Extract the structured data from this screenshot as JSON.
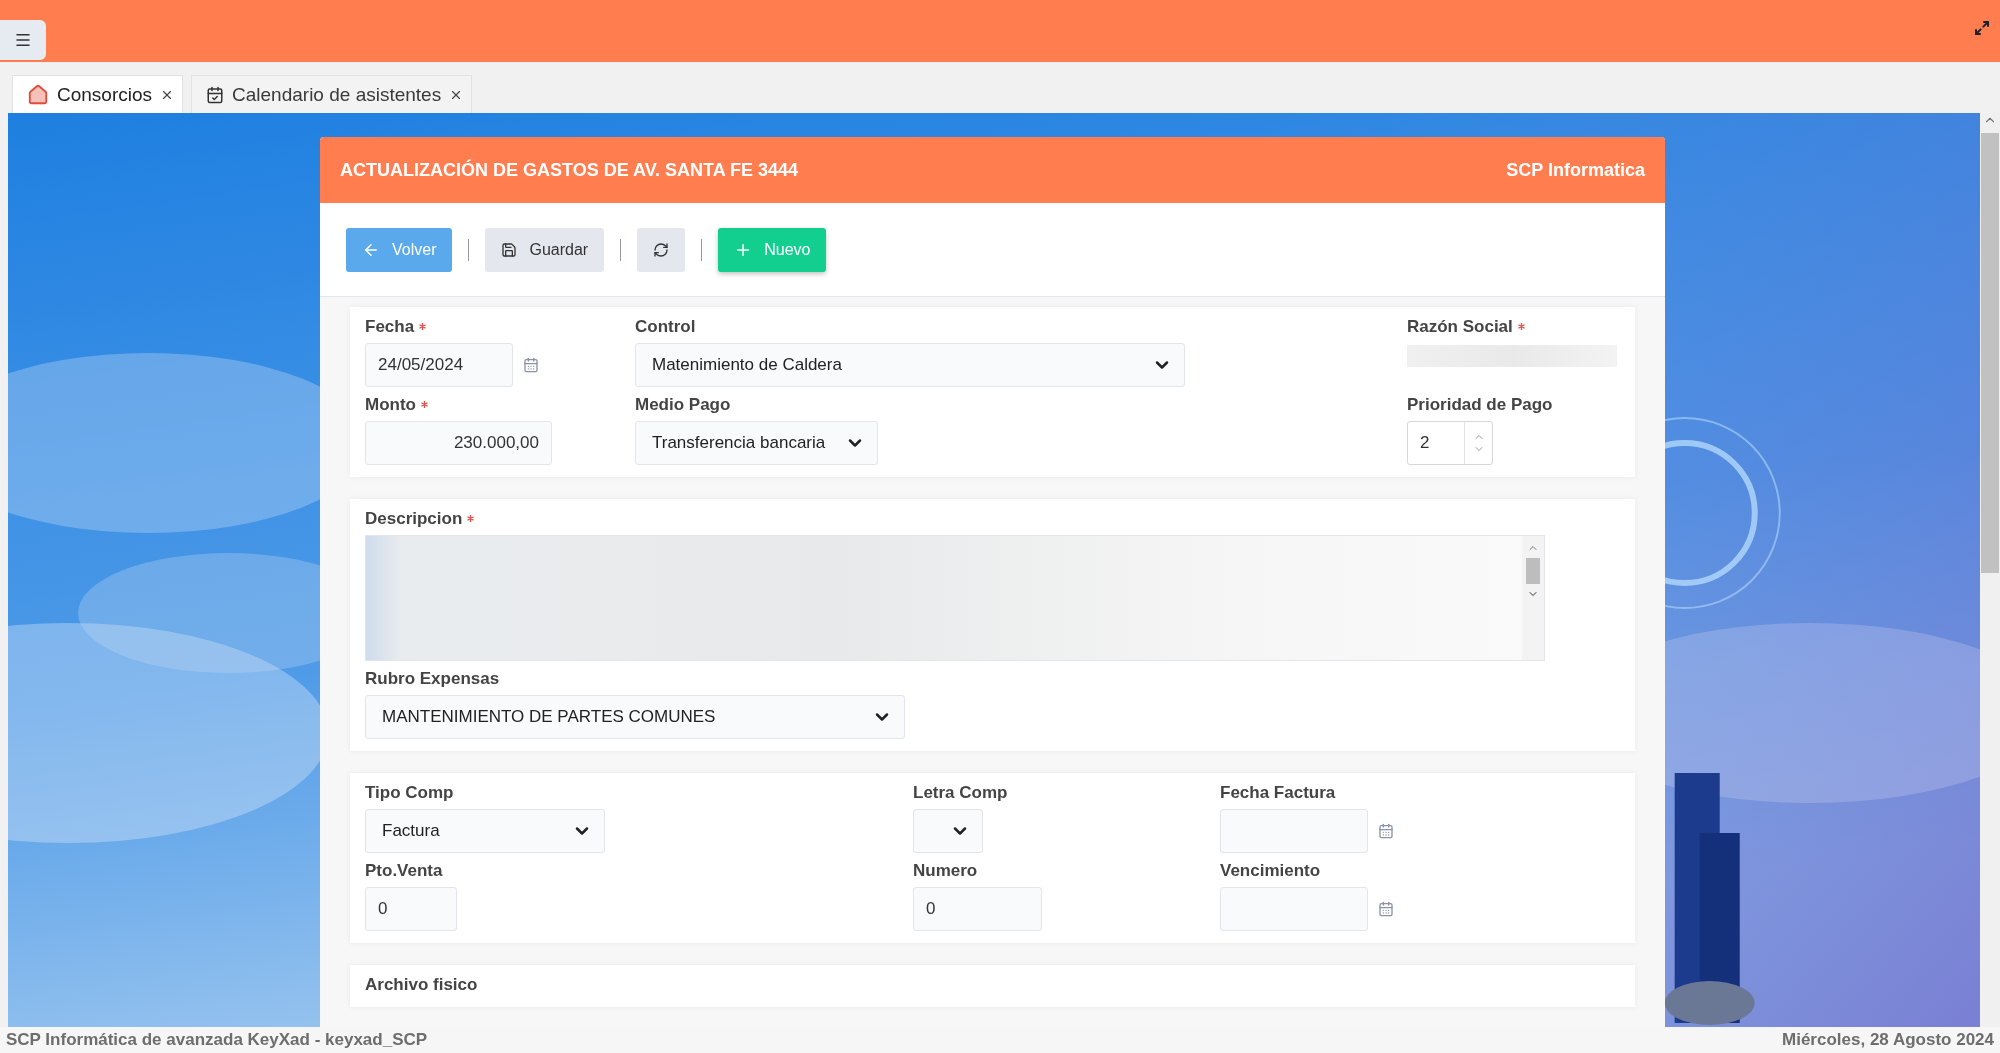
{
  "tabs": [
    {
      "label": "Consorcios",
      "kind": "home",
      "selected": true
    },
    {
      "label": "Calendario de asistentes",
      "kind": "calendar",
      "selected": false
    }
  ],
  "panel": {
    "title": "ACTUALIZACIÓN DE GASTOS DE AV. SANTA FE 3444",
    "brand": "SCP Informatica"
  },
  "toolbar": [
    {
      "kind": "back",
      "label": "Volver"
    },
    {
      "kind": "save",
      "label": "Guardar"
    },
    {
      "kind": "refresh"
    },
    {
      "kind": "new",
      "label": "Nuevo"
    }
  ],
  "sections": [
    {
      "fields": [
        {
          "label": "Fecha",
          "required": true,
          "kind": "date",
          "value": "24/05/2024"
        },
        {
          "label": "Control",
          "required": false,
          "kind": "select",
          "value": "Matenimiento de Caldera"
        },
        {
          "label": "Razón Social",
          "required": true,
          "kind": "blurred"
        },
        {
          "label": "Monto",
          "required": true,
          "kind": "amount",
          "value": "230.000,00"
        },
        {
          "label": "Medio Pago",
          "required": false,
          "kind": "select",
          "value": "Transferencia bancaria"
        },
        {
          "label": "Prioridad de Pago",
          "required": false,
          "kind": "spinner",
          "value": "2"
        }
      ]
    },
    {
      "fields": [
        {
          "label": "Descripcion",
          "required": true,
          "kind": "textarea"
        },
        {
          "label": "Rubro Expensas",
          "required": false,
          "kind": "select",
          "value": "MANTENIMIENTO DE PARTES COMUNES"
        }
      ]
    },
    {
      "fields": [
        {
          "label": "Tipo Comp",
          "required": false,
          "kind": "select",
          "value": "Factura"
        },
        {
          "label": "Letra Comp",
          "required": false,
          "kind": "select"
        },
        {
          "label": "Fecha Factura",
          "required": false,
          "kind": "date"
        },
        {
          "label": "Pto.Venta",
          "required": false,
          "kind": "text",
          "value": "0"
        },
        {
          "label": "Numero",
          "required": false,
          "kind": "text",
          "value": "0"
        },
        {
          "label": "Vencimiento",
          "required": false,
          "kind": "date"
        }
      ]
    },
    {
      "fields": [
        {
          "label": "Archivo fisico",
          "required": false,
          "kind": "heading"
        }
      ]
    }
  ],
  "status_bar": {
    "left": "SCP Informática de avanzada KeyXad - keyxad_SCP",
    "right": "Miércoles, 28 Agosto 2024"
  }
}
